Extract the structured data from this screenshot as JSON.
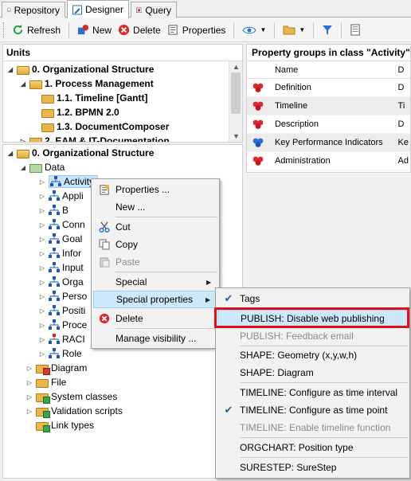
{
  "tabs": [
    {
      "label": "Repository",
      "icon": "database-icon"
    },
    {
      "label": "Designer",
      "icon": "designer-icon"
    },
    {
      "label": "Query",
      "icon": "query-icon"
    }
  ],
  "toolbar": {
    "refresh": "Refresh",
    "new": "New",
    "delete": "Delete",
    "properties": "Properties"
  },
  "units": {
    "title": "Units",
    "items": [
      {
        "label": "0. Organizational Structure"
      },
      {
        "label": "1. Process Management"
      },
      {
        "label": "1.1. Timeline [Gantt]"
      },
      {
        "label": "1.2. BPMN 2.0"
      },
      {
        "label": "1.3. DocumentComposer"
      },
      {
        "label": "2. EAM & IT-Documentation"
      }
    ]
  },
  "tree": {
    "root": "0. Organizational Structure",
    "data": "Data",
    "classes": [
      "Activity",
      "Appli",
      "B",
      "Conn",
      "Goal",
      "Infor",
      "Input",
      "Orga",
      "Perso",
      "Positi",
      "Proce",
      "RACI",
      "Role"
    ],
    "folders": [
      "Diagram",
      "File",
      "System classes",
      "Validation scripts",
      "Link types"
    ]
  },
  "properties": {
    "title": "Property groups in class \"Activity\"",
    "column_name": "Name",
    "column_extra": "D",
    "rows": [
      {
        "name": "Definition",
        "extra": "D",
        "color": "#d9282e"
      },
      {
        "name": "Timeline",
        "extra": "Ti",
        "color": "#d9282e"
      },
      {
        "name": "Description",
        "extra": "D",
        "color": "#d9282e"
      },
      {
        "name": "Key Performance Indicators",
        "extra": "Ke",
        "color": "#2a6fd6"
      },
      {
        "name": "Administration",
        "extra": "Ad",
        "color": "#d9282e"
      }
    ]
  },
  "context_menu": {
    "items": [
      {
        "label": "Properties ...",
        "icon": "properties-icon"
      },
      {
        "label": "New ...",
        "icon": ""
      },
      {
        "label": "Cut",
        "icon": "scissors-icon"
      },
      {
        "label": "Copy",
        "icon": "copy-icon"
      },
      {
        "label": "Paste",
        "icon": "paste-icon"
      },
      {
        "label": "Special",
        "icon": ""
      },
      {
        "label": "Special properties",
        "icon": ""
      },
      {
        "label": "Delete",
        "icon": "delete-icon"
      },
      {
        "label": "Manage visibility ...",
        "icon": ""
      }
    ]
  },
  "submenu": {
    "items": [
      {
        "label": "Tags",
        "checked": true
      },
      {
        "label": "PUBLISH: Disable web publishing",
        "checked": false
      },
      {
        "label": "PUBLISH: Feedback email",
        "checked": false
      },
      {
        "label": "SHAPE: Geometry (x,y,w,h)",
        "checked": false
      },
      {
        "label": "SHAPE: Diagram",
        "checked": false
      },
      {
        "label": "TIMELINE: Configure as time interval",
        "checked": false
      },
      {
        "label": "TIMELINE: Configure as time point",
        "checked": true
      },
      {
        "label": "TIMELINE: Enable timeline function",
        "checked": false
      },
      {
        "label": "ORGCHART: Position type",
        "checked": false
      },
      {
        "label": "SURESTEP: SureStep",
        "checked": false
      }
    ]
  }
}
